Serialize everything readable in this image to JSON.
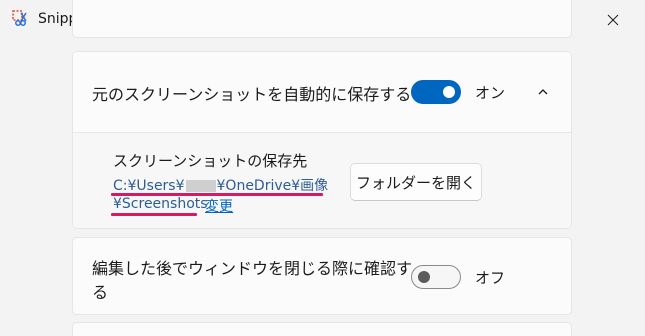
{
  "window": {
    "title": "Snipping Tool"
  },
  "auto_save": {
    "label": "元のスクリーンショットを自動的に保存する",
    "toggle_state": "on",
    "toggle_text": "オン",
    "save_location": {
      "heading": "スクリーンショットの保存先",
      "path_line1_prefix": "C:¥Users¥",
      "path_line1_suffix": "¥OneDrive¥画像",
      "path_line2": "¥Screenshots",
      "change_link": "変更",
      "open_folder_button": "フォルダーを開く"
    }
  },
  "confirm_close": {
    "label_line1": "編集した後でウィンドウを閉じる際に確認す",
    "label_line2": "る",
    "toggle_state": "off",
    "toggle_text": "オフ"
  },
  "colors": {
    "accent": "#0067c0",
    "highlight_underline": "#d81b60",
    "link": "#2c5d94"
  }
}
